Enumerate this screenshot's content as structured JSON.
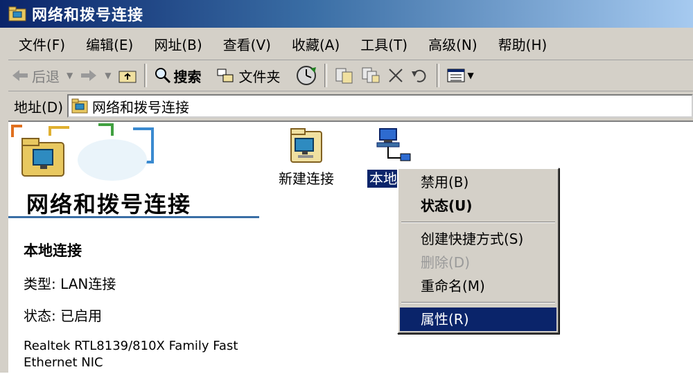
{
  "window": {
    "title": "网络和拨号连接"
  },
  "menubar": {
    "items": [
      {
        "label": "文件(F)"
      },
      {
        "label": "编辑(E)"
      },
      {
        "label": "网址(B)"
      },
      {
        "label": "查看(V)"
      },
      {
        "label": "收藏(A)"
      },
      {
        "label": "工具(T)"
      },
      {
        "label": "高级(N)"
      },
      {
        "label": "帮助(H)"
      }
    ]
  },
  "toolbar": {
    "back_label": "后退",
    "search_label": "搜索",
    "folders_label": "文件夹"
  },
  "address": {
    "label": "地址(D)",
    "value": "网络和拨号连接"
  },
  "panel": {
    "title": "网络和拨号连接",
    "selected_name": "本地连接",
    "type_text": "类型: LAN连接",
    "status_text": "状态: 已启用",
    "device_text": "Realtek RTL8139/810X Family Fast Ethernet NIC"
  },
  "icons": {
    "new_connection_label": "新建连接",
    "local_connection_label": "本地"
  },
  "context_menu": {
    "items": [
      {
        "label": "禁用(B)"
      },
      {
        "label": "状态(U)"
      },
      {
        "label": "创建快捷方式(S)"
      },
      {
        "label": "删除(D)"
      },
      {
        "label": "重命名(M)"
      },
      {
        "label": "属性(R)"
      }
    ]
  },
  "colors": {
    "titlebar": "#0a246a",
    "chrome": "#d4d0c8",
    "selection": "#0a246a",
    "accent_line": "#3a6ea5"
  }
}
